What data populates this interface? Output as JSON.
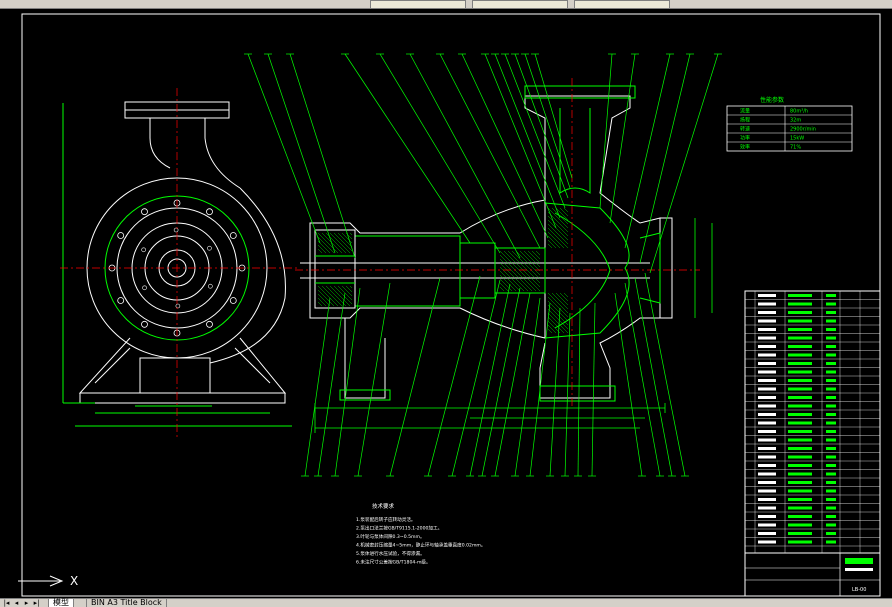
{
  "toolbar": {
    "combo1": "",
    "combo2": "",
    "combo3": ""
  },
  "drawing": {
    "tech_requirements_title": "技术要求",
    "tech_requirements": [
      "1.泵装配后转子应转动灵活。",
      "2.泵出口法兰按GB/T9115.1-2000加工。",
      "3.叶轮与泵体间隙0.3~0.5mm。",
      "4.机械密封压缩量4~5mm，静止环与轴承盖垂直度0.02mm。",
      "5.泵体进行水压试验，不得渗漏。",
      "6.未注尺寸公差按GB/T1804-m级。"
    ],
    "perf_title": "性能参数",
    "perf_rows": [
      [
        "流量",
        "80m³/h"
      ],
      [
        "扬程",
        "32m"
      ],
      [
        "转速",
        "2900r/min"
      ],
      [
        "功率",
        "15kW"
      ],
      [
        "效率",
        "71%"
      ]
    ],
    "title_block": {
      "drawing_no": "LB-00"
    }
  },
  "tabs": {
    "model_label": "模型",
    "layout_label": "BIN A3 Title Block"
  },
  "colors": {
    "lines_primary": "#00ff00",
    "lines_secondary": "#ffffff",
    "background": "#000000"
  }
}
